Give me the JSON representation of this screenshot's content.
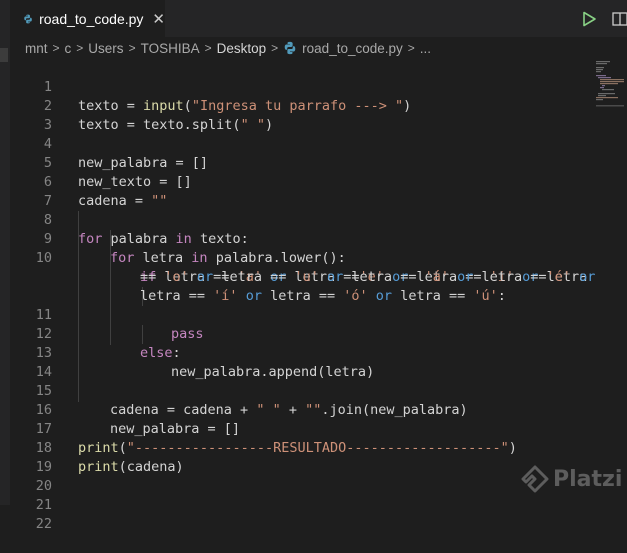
{
  "tab": {
    "filename": "road_to_code.py",
    "close": "✕"
  },
  "breadcrumb": [
    "mnt",
    "c",
    "Users",
    "TOSHIBA",
    "Desktop",
    "road_to_code.py",
    "..."
  ],
  "lines": {
    "l1": {
      "num": "1"
    },
    "l2": {
      "num": "2"
    },
    "l3": {
      "num": "3"
    },
    "l4": {
      "num": "4"
    },
    "l5": {
      "num": "5"
    },
    "l6": {
      "num": "6"
    },
    "l7": {
      "num": "7"
    },
    "l8": {
      "num": "8"
    },
    "l9": {
      "num": "9"
    },
    "l10": {
      "num": "10"
    },
    "l11": {
      "num": "11"
    },
    "l12": {
      "num": "12"
    },
    "l13": {
      "num": "13"
    },
    "l14": {
      "num": "14"
    },
    "l15": {
      "num": "15"
    },
    "l16": {
      "num": "16"
    },
    "l17": {
      "num": "17"
    },
    "l18": {
      "num": "18"
    },
    "l19": {
      "num": "19"
    },
    "l20": {
      "num": "20"
    },
    "l21": {
      "num": "21"
    },
    "l22": {
      "num": "22"
    }
  },
  "code": {
    "t_texto": "texto",
    "t_eq": " = ",
    "t_input": "input",
    "t_lp": "(",
    "t_rp": ")",
    "s_prompt": "\"Ingresa tu parrafo ---> \"",
    "t_split": "texto.split(",
    "s_space": "\" \"",
    "l4": "new_palabra = []",
    "l5": "new_texto = []",
    "l6a": "cadena = ",
    "s_empty": "\"\"",
    "k_for": "for",
    "k_in": "in",
    "k_if": "if",
    "k_or": "or",
    "k_pass": "pass",
    "k_else": "else",
    "l8_mid": " palabra ",
    "l8_end": " texto:",
    "l9_mid": " letra ",
    "l9_end": " palabra.lower():",
    "v_letra": "letra",
    "op_eq": " == ",
    "op_eq2": " ==",
    "op_eq3": "== ",
    "s_a": "'a'",
    "s_e": "'e'",
    "s_i": "'i'",
    "s_o": "'o'",
    "s_u": "'u'",
    "s_aa": "'á'",
    "s_ee": "'é'",
    "s_ii": "'í'",
    "s_oo": "'ó'",
    "s_uu": "'ú'",
    "colon": ":",
    "l13": "new_palabra.append(letra)",
    "l15a": "cadena = cadena + ",
    "l15b": " + ",
    "l15c": ".join(new_palabra)",
    "l16": "new_palabra = []",
    "t_print": "print",
    "s_result": "\"-----------------RESULTADO-------------------\"",
    "l18b": "(cadena)"
  },
  "watermark": "Platzi",
  "icons": [
    "python-file-icon",
    "run-icon",
    "split-editor-icon",
    "platzi-logo-icon"
  ]
}
